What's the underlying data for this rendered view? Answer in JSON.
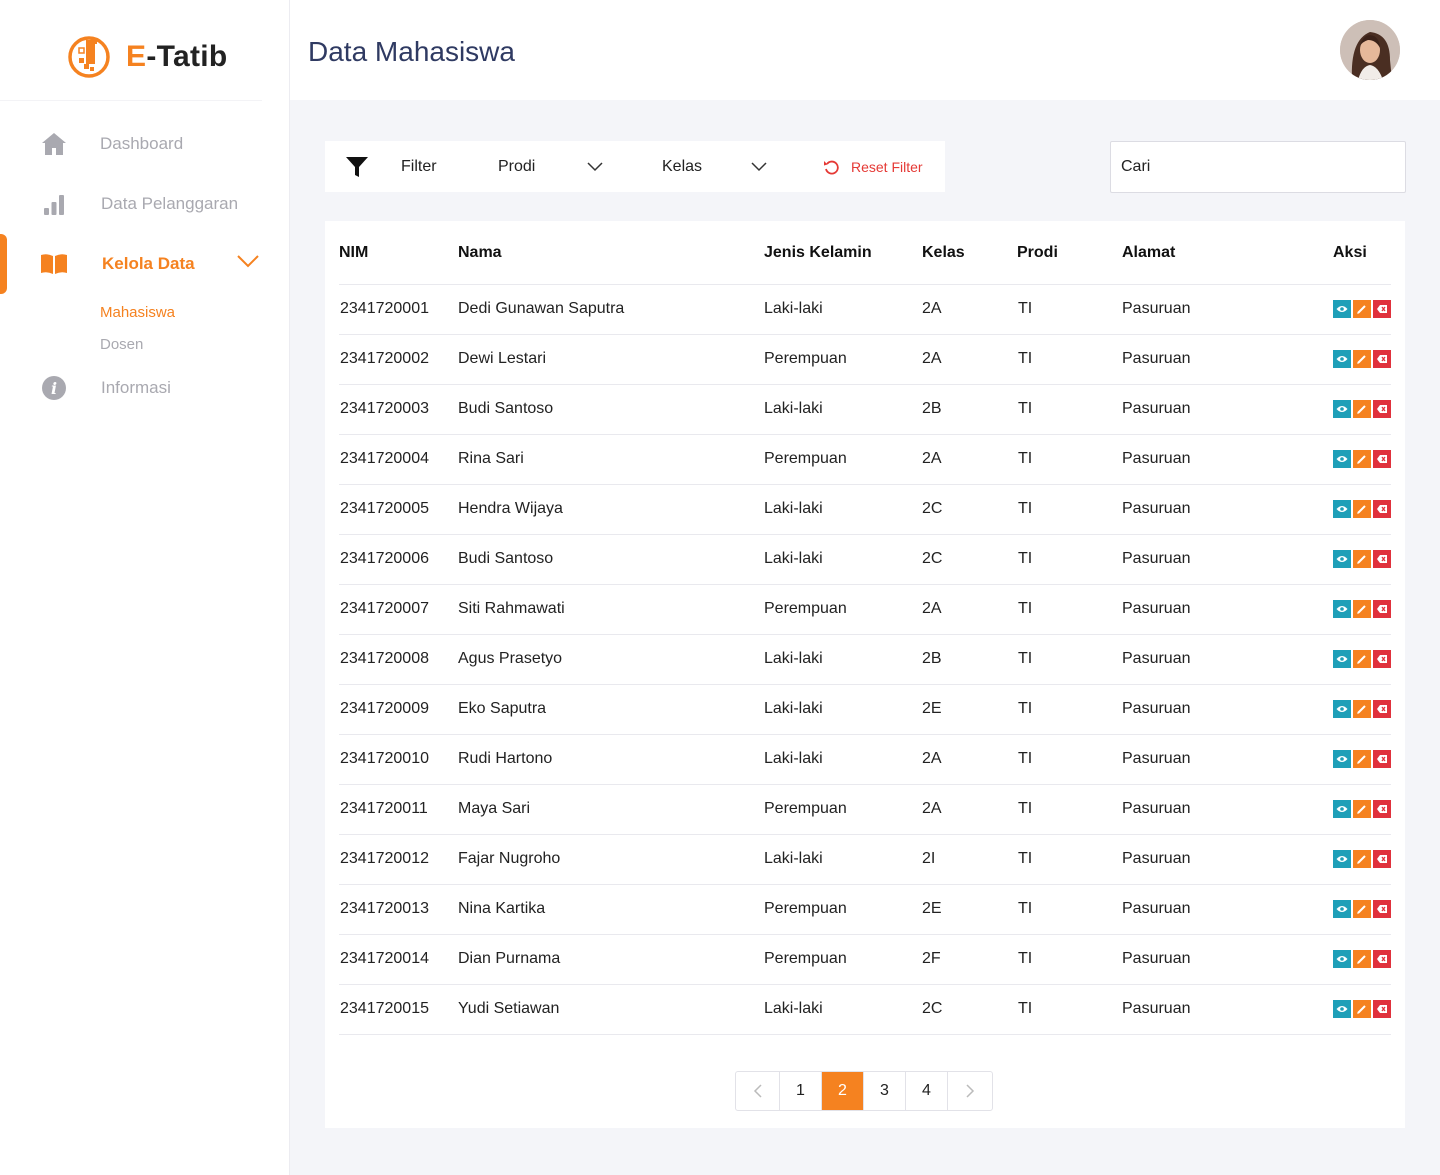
{
  "app": {
    "logo_prefix": "E",
    "logo_suffix": "-Tatib"
  },
  "header": {
    "title": "Data Mahasiswa",
    "avatar_icon": "user-avatar"
  },
  "sidebar": {
    "items": [
      {
        "label": "Dashboard",
        "icon": "home-icon"
      },
      {
        "label": "Data Pelanggaran",
        "icon": "bar-chart-icon"
      },
      {
        "label": "Kelola Data",
        "icon": "book-icon",
        "active": true
      },
      {
        "label": "Informasi",
        "icon": "info-icon"
      }
    ],
    "subitems": [
      {
        "label": "Mahasiswa",
        "active": true
      },
      {
        "label": "Dosen"
      }
    ]
  },
  "filter": {
    "label": "Filter",
    "prodi": "Prodi",
    "kelas": "Kelas",
    "reset": "Reset Filter"
  },
  "search": {
    "placeholder": "Cari"
  },
  "table": {
    "headers": {
      "nim": "NIM",
      "nama": "Nama",
      "jk": "Jenis Kelamin",
      "kelas": "Kelas",
      "prodi": "Prodi",
      "alamat": "Alamat",
      "aksi": "Aksi"
    },
    "rows": [
      {
        "nim": "2341720001",
        "nama": "Dedi Gunawan Saputra",
        "jk": "Laki-laki",
        "kelas": "2A",
        "prodi": "TI",
        "alamat": "Pasuruan"
      },
      {
        "nim": "2341720002",
        "nama": "Dewi Lestari",
        "jk": "Perempuan",
        "kelas": "2A",
        "prodi": "TI",
        "alamat": "Pasuruan"
      },
      {
        "nim": "2341720003",
        "nama": "Budi Santoso",
        "jk": "Laki-laki",
        "kelas": "2B",
        "prodi": "TI",
        "alamat": "Pasuruan"
      },
      {
        "nim": "2341720004",
        "nama": "Rina Sari",
        "jk": "Perempuan",
        "kelas": "2A",
        "prodi": "TI",
        "alamat": "Pasuruan"
      },
      {
        "nim": "2341720005",
        "nama": "Hendra Wijaya",
        "jk": "Laki-laki",
        "kelas": "2C",
        "prodi": "TI",
        "alamat": "Pasuruan"
      },
      {
        "nim": "2341720006",
        "nama": "Budi Santoso",
        "jk": "Laki-laki",
        "kelas": "2C",
        "prodi": "TI",
        "alamat": "Pasuruan"
      },
      {
        "nim": "2341720007",
        "nama": "Siti Rahmawati",
        "jk": "Perempuan",
        "kelas": "2A",
        "prodi": "TI",
        "alamat": "Pasuruan"
      },
      {
        "nim": "2341720008",
        "nama": "Agus Prasetyo",
        "jk": "Laki-laki",
        "kelas": "2B",
        "prodi": "TI",
        "alamat": "Pasuruan"
      },
      {
        "nim": "2341720009",
        "nama": "Eko Saputra",
        "jk": "Laki-laki",
        "kelas": "2E",
        "prodi": "TI",
        "alamat": "Pasuruan"
      },
      {
        "nim": "2341720010",
        "nama": "Rudi Hartono",
        "jk": "Laki-laki",
        "kelas": "2A",
        "prodi": "TI",
        "alamat": "Pasuruan"
      },
      {
        "nim": "2341720011",
        "nama": "Maya Sari",
        "jk": "Perempuan",
        "kelas": "2A",
        "prodi": "TI",
        "alamat": "Pasuruan"
      },
      {
        "nim": "2341720012",
        "nama": "Fajar Nugroho",
        "jk": "Laki-laki",
        "kelas": "2I",
        "prodi": "TI",
        "alamat": "Pasuruan"
      },
      {
        "nim": "2341720013",
        "nama": "Nina Kartika",
        "jk": "Perempuan",
        "kelas": "2E",
        "prodi": "TI",
        "alamat": "Pasuruan"
      },
      {
        "nim": "2341720014",
        "nama": "Dian Purnama",
        "jk": "Perempuan",
        "kelas": "2F",
        "prodi": "TI",
        "alamat": "Pasuruan"
      },
      {
        "nim": "2341720015",
        "nama": "Yudi Setiawan",
        "jk": "Laki-laki",
        "kelas": "2C",
        "prodi": "TI",
        "alamat": "Pasuruan"
      }
    ]
  },
  "pagination": {
    "pages": [
      "1",
      "2",
      "3",
      "4"
    ],
    "current": "2"
  },
  "colors": {
    "accent": "#f58220",
    "view": "#1e9fb8",
    "delete": "#e0313c",
    "title": "#2f3a62"
  }
}
